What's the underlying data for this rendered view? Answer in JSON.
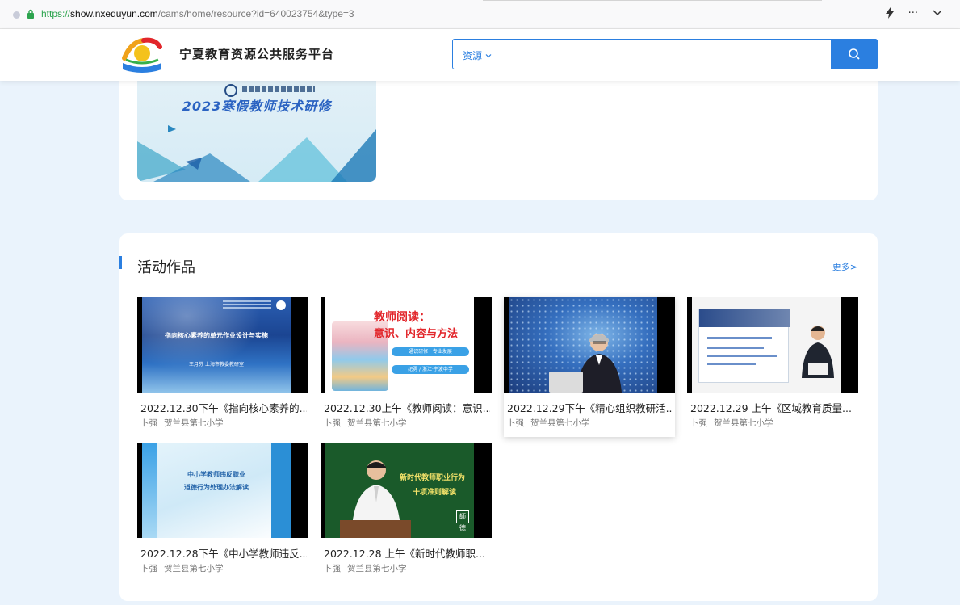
{
  "browser": {
    "url_scheme": "https://",
    "url_host": "show.nxeduyun.com",
    "url_path": "/cams/home/resource?id=640023754&type=3",
    "icons": [
      "info-icon",
      "lock-icon",
      "lightning-icon",
      "overflow-menu-icon",
      "chevron-down-icon"
    ],
    "overflow_label": "···"
  },
  "header": {
    "site_title": "宁夏教育资源公共服务平台",
    "search_scope": "资源",
    "search_placeholder": "",
    "search_icon": "search-icon"
  },
  "banner": {
    "title": "2023寒假教师技术研修"
  },
  "section": {
    "title": "活动作品",
    "more_label": "更多>",
    "accent_color": "#2b7fe0"
  },
  "items": [
    {
      "title": "2022.12.30下午《指向核心素养的...",
      "author": "卜强",
      "school": "贺兰县第七小学",
      "thumb_lines": [
        "指向核心素养的单元作业设计与实施",
        "王月芬 上海市教委教研室"
      ]
    },
    {
      "title": "2022.12.30上午《教师阅读：意识...",
      "author": "卜强",
      "school": "贺兰县第七小学",
      "thumb_lines": [
        "教师阅读：",
        "意识、内容与方法",
        "通识研修 · 专业发展",
        "纪勇 / 浙江·宁波中学"
      ]
    },
    {
      "title": "2022.12.29下午《精心组织教研活...",
      "author": "卜强",
      "school": "贺兰县第七小学"
    },
    {
      "title": "2022.12.29 上午《区域教育质量...",
      "author": "卜强",
      "school": "贺兰县第七小学"
    },
    {
      "title": "2022.12.28下午《中小学教师违反...",
      "author": "卜强",
      "school": "贺兰县第七小学",
      "thumb_lines": [
        "中小学教师违反职业",
        "道德行为处理办法解读"
      ]
    },
    {
      "title": "2022.12.28 上午《新时代教师职...",
      "author": "卜强",
      "school": "贺兰县第七小学",
      "thumb_lines": [
        "新时代教师职业行为",
        "十项准则解读",
        "師德"
      ]
    }
  ]
}
